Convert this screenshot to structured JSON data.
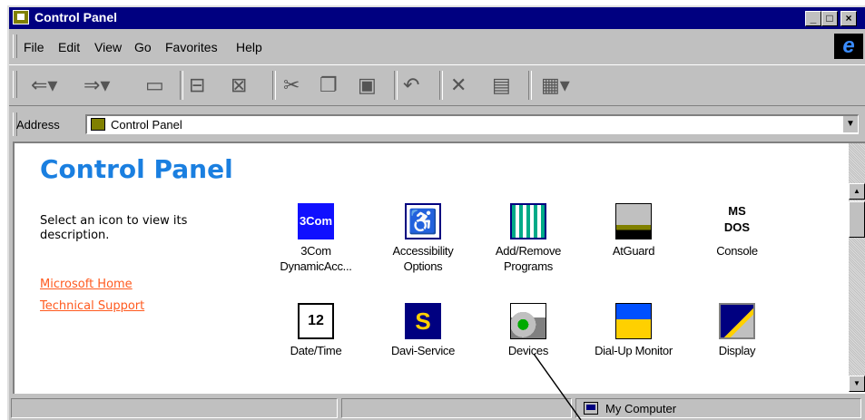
{
  "window": {
    "title": "Control Panel"
  },
  "menu": {
    "items": [
      "File",
      "Edit",
      "View",
      "Go",
      "Favorites",
      "Help"
    ]
  },
  "address": {
    "label": "Address",
    "value": "Control Panel"
  },
  "content": {
    "heading": "Control Panel",
    "description": "Select an icon to view its description.",
    "links": [
      "Microsoft Home",
      "Technical Support"
    ],
    "icons": [
      {
        "label": "3Com DynamicAcc...",
        "icon": "3com-icon",
        "badge": "3Com"
      },
      {
        "label": "Accessibility Options",
        "icon": "accessibility-icon"
      },
      {
        "label": "Add/Remove Programs",
        "icon": "add-remove-programs-icon"
      },
      {
        "label": "AtGuard",
        "icon": "atguard-icon"
      },
      {
        "label": "Console",
        "icon": "console-icon",
        "badge": "MS DOS"
      },
      {
        "label": "Date/Time",
        "icon": "date-time-icon",
        "badge": "12"
      },
      {
        "label": "Davi-Service",
        "icon": "davi-service-icon",
        "badge": "S"
      },
      {
        "label": "Devices",
        "icon": "devices-icon"
      },
      {
        "label": "Dial-Up Monitor",
        "icon": "dialup-monitor-icon"
      },
      {
        "label": "Display",
        "icon": "display-icon"
      }
    ]
  },
  "status": {
    "zone": "My Computer"
  },
  "colors": {
    "titlebar": "#000080",
    "heading": "#1a7fe0",
    "link": "#ff5a1f"
  }
}
